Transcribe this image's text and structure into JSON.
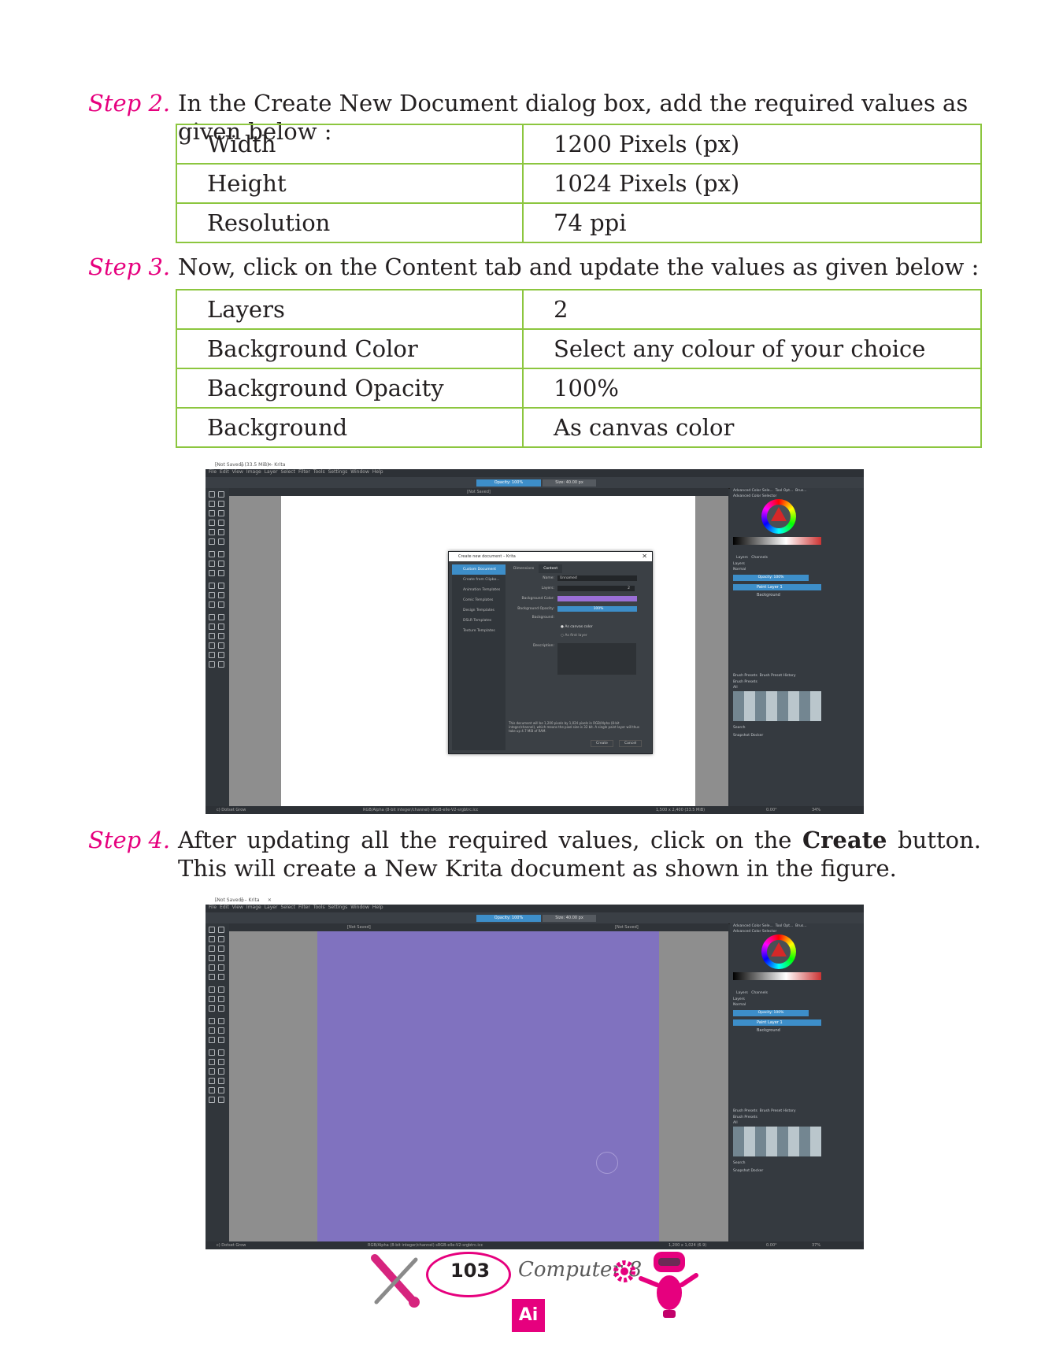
{
  "step2": {
    "label": "Step 2.",
    "text": "In the Create New Document dialog box, add the required values as given below :",
    "rows": [
      {
        "name": "Width",
        "value": "1200 Pixels (px)"
      },
      {
        "name": "Height",
        "value": "1024 Pixels (px)"
      },
      {
        "name": "Resolution",
        "value": "74 ppi"
      }
    ]
  },
  "step3": {
    "label": "Step 3.",
    "text": "Now, click on the Content tab and update the values as given below :",
    "rows": [
      {
        "name": "Layers",
        "value": "2"
      },
      {
        "name": "Background Color",
        "value": "Select any colour of your choice"
      },
      {
        "name": "Background Opacity",
        "value": "100%"
      },
      {
        "name": "Background",
        "value": "As canvas color"
      }
    ]
  },
  "step4": {
    "label": "Step 4.",
    "text_before": "After updating all the required values, click on the ",
    "text_bold": "Create",
    "text_after": " button. This will create a New Krita document as shown in the figure."
  },
  "krita": {
    "window_title_1": "[Not Saved] (33.5 MiB) – Krita",
    "window_title_2": "[Not Saved] – Krita",
    "menu": [
      "File",
      "Edit",
      "View",
      "Image",
      "Layer",
      "Select",
      "Filter",
      "Tools",
      "Settings",
      "Window",
      "Help"
    ],
    "opacity": "Opacity: 100%",
    "size": "Size: 40.00 px",
    "doc_tab": "[Not Saved]",
    "right_tabs": [
      "Advanced Color Sele...",
      "Tool Opt...",
      "Brus..."
    ],
    "adv_color_title": "Advanced Color Selector",
    "layers_tabs": [
      "Layers",
      "Channels"
    ],
    "layers_label": "Layers",
    "blend_mode": "Normal",
    "layer_opacity": "Opacity: 100%",
    "layers": [
      "Paint Layer 1",
      "Background"
    ],
    "brush_tabs": [
      "Brush Presets",
      "Brush Preset History"
    ],
    "brush_presets_label": "Brush Presets",
    "brush_filter": "All",
    "search_label": "Search",
    "snapshot": "Snapshot Docker",
    "status_brush": "c) Dotset Grow",
    "status_color_1": "RGB/Alpha (8-bit integer/channel)  sRGB-elle-V2-srgbtrc.icc",
    "status_size_1": "1,500 x 2,400 (33.5 MiB)",
    "status_color_2": "RGB/Alpha (8-bit integer/channel)  sRGB-elle-V2-srgbtrc.icc",
    "status_size_2": "1,200 x 1,024 (6.9)",
    "angle": "0.00°",
    "zoom_1": "34%",
    "zoom_2": "37%",
    "canvas_color": "#8072bf"
  },
  "dialog": {
    "title": "Create new document – Krita",
    "sidebar": [
      "Custom Document",
      "Create from Clipbo...",
      "Animation Templates",
      "Comic Templates",
      "Design Templates",
      "DSLR Templates",
      "Texture Templates"
    ],
    "tabs": [
      "Dimensions",
      "Content"
    ],
    "name_label": "Name:",
    "name_value": "Unnamed",
    "layers_label": "Layers:",
    "layers_value": "2",
    "bg_color_label": "Background Color:",
    "bg_opacity_label": "Background Opacity:",
    "bg_opacity_value": "100%",
    "background_label": "Background:",
    "bg_options": [
      "As canvas color",
      "As first layer"
    ],
    "description_label": "Description:",
    "note": "This document will be 1,200 pixels by 1,024 pixels in RGB/Alpha (8-bit integer/channel), which means the pixel size is 32 bit. A single paint layer will thus take up 4.7 MiB of RAM.",
    "create_button": "Create",
    "cancel_button": "Cancel"
  },
  "footer": {
    "page_number": "103",
    "book_title": "Computer-8",
    "badge": "Ai"
  }
}
